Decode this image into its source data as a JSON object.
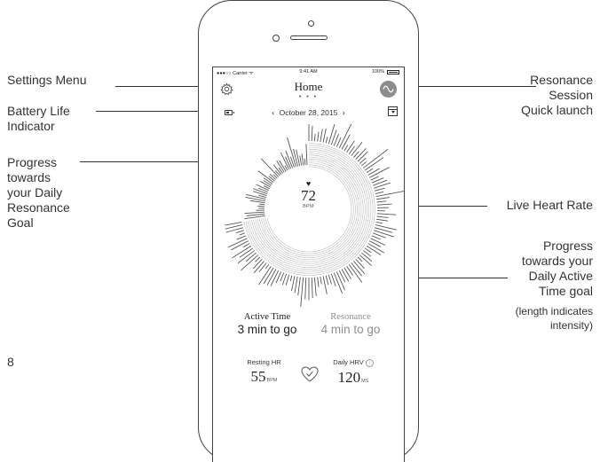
{
  "annotations": {
    "settings_menu": "Settings Menu",
    "battery_life": [
      "Battery Life",
      "Indicator"
    ],
    "progress_resonance": [
      "Progress",
      "towards",
      "your Daily",
      "Resonance",
      "Goal"
    ],
    "resonance_session": [
      "Resonance",
      "Session",
      "Quick launch"
    ],
    "live_heart_rate": "Live Heart Rate",
    "progress_active": [
      "Progress",
      "towards your",
      "Daily Active",
      "Time goal"
    ],
    "length_note": [
      "(length indicates",
      "intensity)"
    ]
  },
  "page_number": "8",
  "status_bar": {
    "carrier": "●●●○○ Carrier ᯤ",
    "time": "9:41 AM",
    "battery": "100%"
  },
  "nav": {
    "title": "Home",
    "page_dots": "● ● ●"
  },
  "date_bar": {
    "prev": "‹",
    "date": "October 28, 2015",
    "next": "›"
  },
  "heart_rate": {
    "symbol": "♥",
    "value": "72",
    "unit": "BPM"
  },
  "metrics": {
    "active_time": {
      "label": "Active Time",
      "value": "3 min to go"
    },
    "resonance": {
      "label": "Resonance",
      "value": "4 min to go"
    }
  },
  "stats": {
    "resting_hr": {
      "label": "Resting HR",
      "value": "55",
      "unit": "BPM"
    },
    "daily_hrv": {
      "label": "Daily HRV",
      "info": "i",
      "value": "120",
      "unit": "MS"
    }
  },
  "icons": [
    "gear-icon",
    "resonance-wave-icon",
    "battery-icon",
    "calendar-dropdown-icon",
    "heart-icon",
    "heart-check-icon",
    "info-icon"
  ],
  "colors": {
    "ink": "#333333",
    "resonance_gray": "#8f8f8f",
    "ring": "#b5b5b5",
    "active_spikes": "#555555"
  },
  "progress": {
    "resonance_ring_fraction": 0.72
  }
}
